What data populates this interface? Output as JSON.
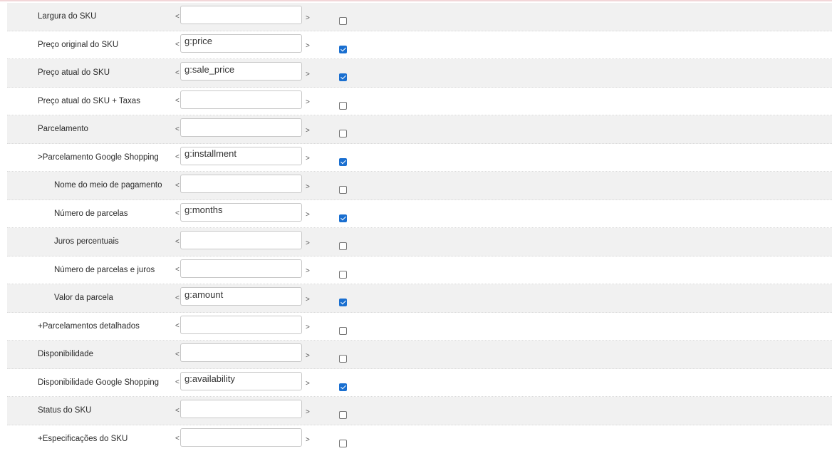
{
  "rows": [
    {
      "label": "Largura do SKU",
      "value": "",
      "checked": false,
      "indent": false
    },
    {
      "label": "Preço original do SKU",
      "value": "g:price",
      "checked": true,
      "indent": false
    },
    {
      "label": "Preço atual do SKU",
      "value": "g:sale_price",
      "checked": true,
      "indent": false
    },
    {
      "label": "Preço atual do SKU + Taxas",
      "value": "",
      "checked": false,
      "indent": false
    },
    {
      "label": "Parcelamento",
      "value": "",
      "checked": false,
      "indent": false
    },
    {
      "label": ">Parcelamento Google Shopping",
      "value": "g:installment",
      "checked": true,
      "indent": false
    },
    {
      "label": "Nome do meio de pagamento",
      "value": "",
      "checked": false,
      "indent": true
    },
    {
      "label": "Número de parcelas",
      "value": "g:months",
      "checked": true,
      "indent": true
    },
    {
      "label": "Juros percentuais",
      "value": "",
      "checked": false,
      "indent": true
    },
    {
      "label": "Número de parcelas e juros",
      "value": "",
      "checked": false,
      "indent": true
    },
    {
      "label": "Valor da parcela",
      "value": "g:amount",
      "checked": true,
      "indent": true
    },
    {
      "label": "+Parcelamentos detalhados",
      "value": "",
      "checked": false,
      "indent": false
    },
    {
      "label": "Disponibilidade",
      "value": "",
      "checked": false,
      "indent": false
    },
    {
      "label": "Disponibilidade Google Shopping",
      "value": "g:availability",
      "checked": true,
      "indent": false
    },
    {
      "label": "Status do SKU",
      "value": "",
      "checked": false,
      "indent": false
    },
    {
      "label": "+Especificações do SKU",
      "value": "",
      "checked": false,
      "indent": false
    }
  ],
  "brackets": {
    "open": "<",
    "close": ">"
  },
  "colors": {
    "alt_row": "#f1f1f1",
    "checkbox_checked": "#1a6fd0"
  }
}
